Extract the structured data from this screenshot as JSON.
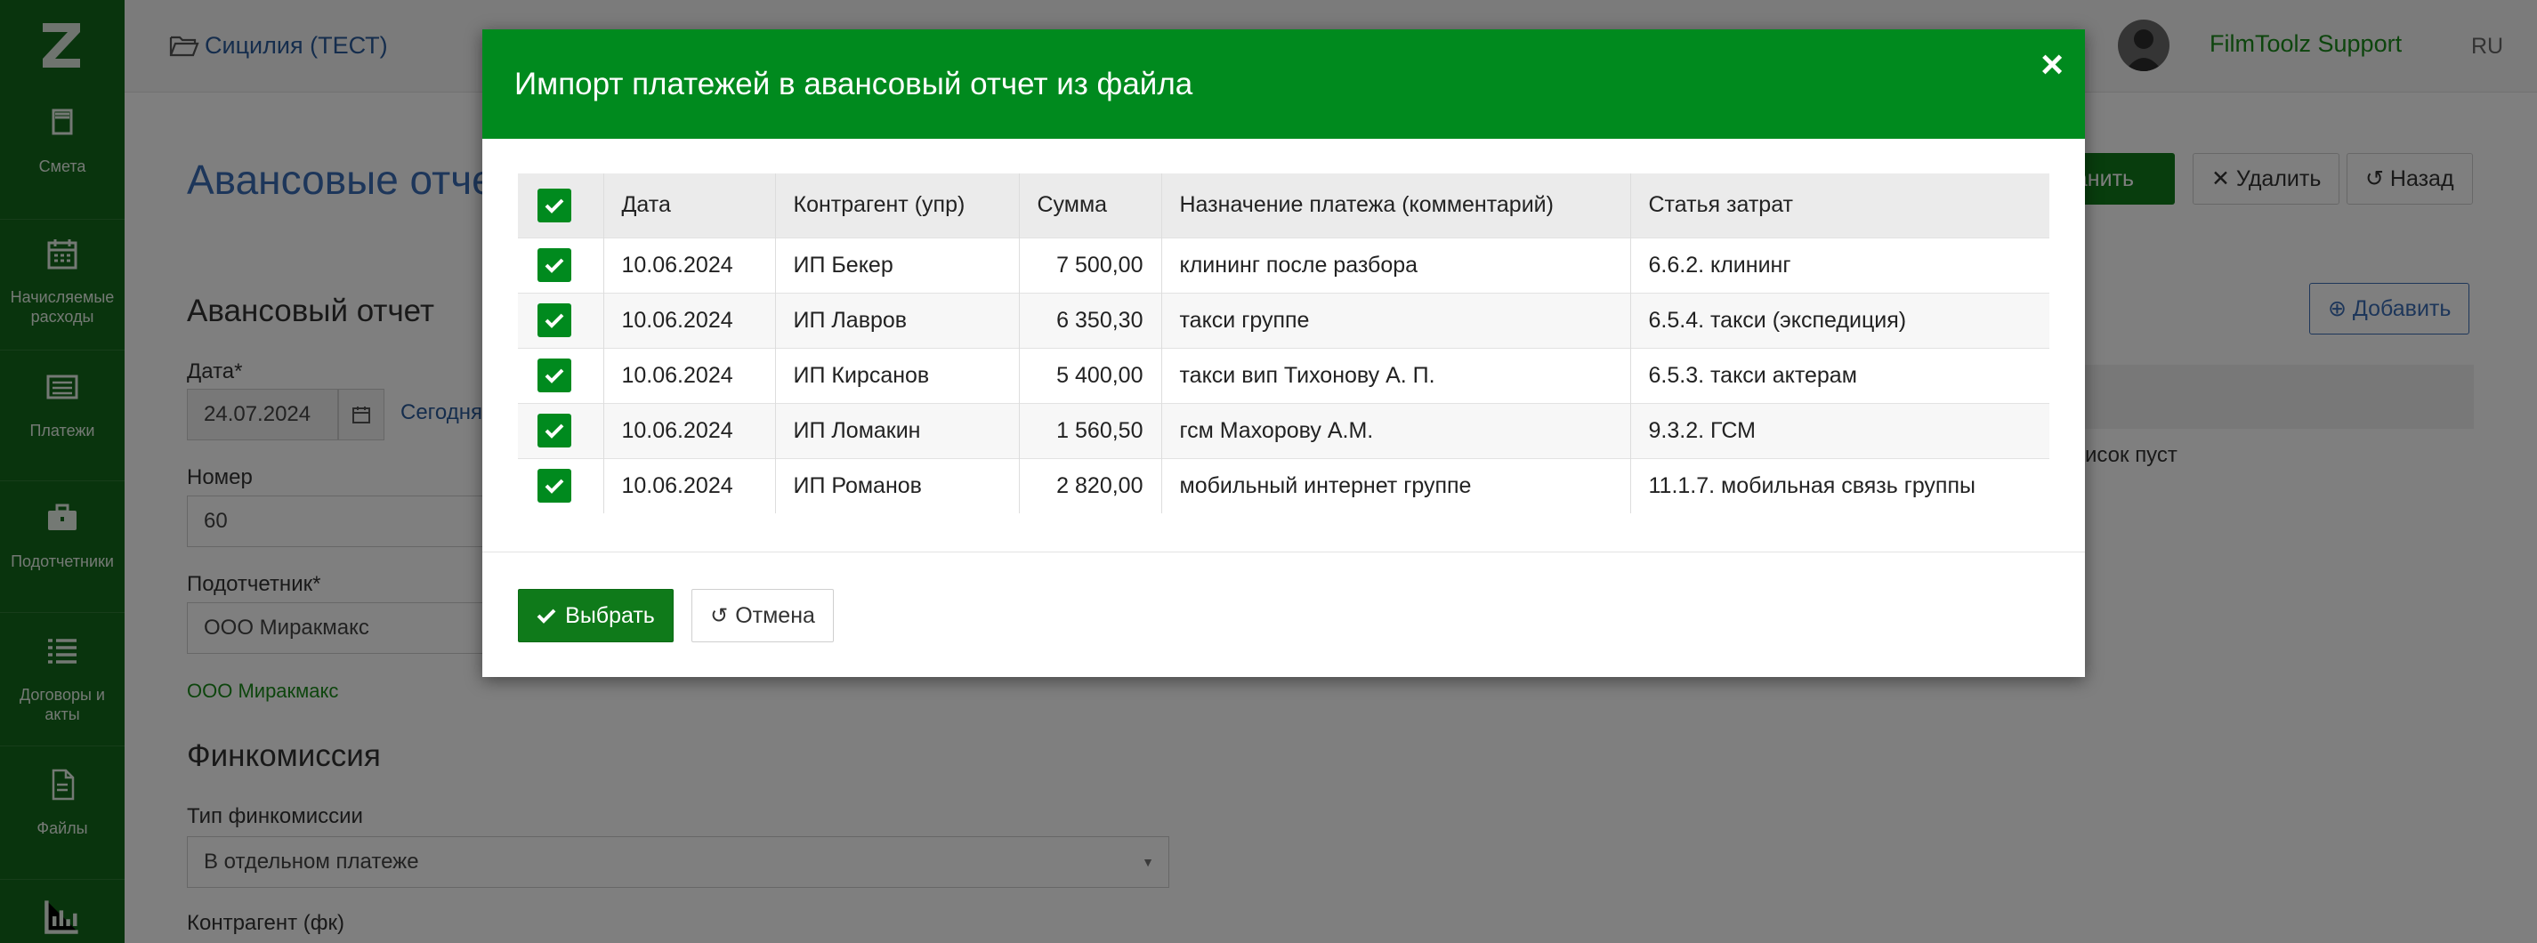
{
  "sidebar": {
    "items": [
      {
        "label": "Смета",
        "icon": "book-icon"
      },
      {
        "label": "Начисляемые расходы",
        "icon": "calendar-icon"
      },
      {
        "label": "Платежи",
        "icon": "list-card-icon"
      },
      {
        "label": "Подотчетники",
        "icon": "briefcase-icon"
      },
      {
        "label": "Договоры и акты",
        "icon": "list-icon"
      },
      {
        "label": "Файлы",
        "icon": "file-icon"
      }
    ]
  },
  "topbar": {
    "project": "Сицилия (ТЕСТ)",
    "user": "FilmToolz Support",
    "lang": "RU"
  },
  "page": {
    "title": "Авансовые отчеты",
    "save_label": "ранить",
    "delete_label": "Удалить",
    "back_label": "Назад",
    "section_report": "Авансовый отчет",
    "date_label": "Дата",
    "date_value": "24.07.2024",
    "today_link": "Сегодня",
    "number_label": "Номер",
    "number_value": "60",
    "accountable_label": "Подотчетник",
    "accountable_value": "ООО Миракмакс",
    "accountable_link": "ООО Миракмакс",
    "section_fincom": "Финкомиссия",
    "fincom_type_label": "Тип финкомиссии",
    "fincom_type_value": "В отдельном платеже",
    "counterparty_label": "Контрагент (фк)",
    "add_label": "Добавить",
    "empty_text": "писок пуст"
  },
  "modal": {
    "title": "Импорт платежей в авансовый отчет из файла",
    "columns": [
      "Дата",
      "Контрагент (упр)",
      "Сумма",
      "Назначение платежа (комментарий)",
      "Статья затрат"
    ],
    "rows": [
      {
        "date": "10.06.2024",
        "counterparty": "ИП Бекер",
        "amount": "7 500,00",
        "purpose": "клининг после разбора",
        "article": "6.6.2. клининг"
      },
      {
        "date": "10.06.2024",
        "counterparty": "ИП Лавров",
        "amount": "6 350,30",
        "purpose": "такси группе",
        "article": "6.5.4. такси (экспедиция)"
      },
      {
        "date": "10.06.2024",
        "counterparty": "ИП Кирсанов",
        "amount": "5 400,00",
        "purpose": "такси вип Тихонову А. П.",
        "article": "6.5.3. такси актерам"
      },
      {
        "date": "10.06.2024",
        "counterparty": "ИП Ломакин",
        "amount": "1 560,50",
        "purpose": "гсм Махорову А.М.",
        "article": "9.3.2. ГСМ"
      },
      {
        "date": "10.06.2024",
        "counterparty": "ИП Романов",
        "amount": "2 820,00",
        "purpose": "мобильный интернет группе",
        "article": "11.1.7. мобильная связь группы"
      }
    ],
    "select_label": "Выбрать",
    "cancel_label": "Отмена"
  },
  "colors": {
    "brand_green": "#008a1e",
    "sidebar_green": "#12691a",
    "link_blue": "#3b6db5"
  }
}
